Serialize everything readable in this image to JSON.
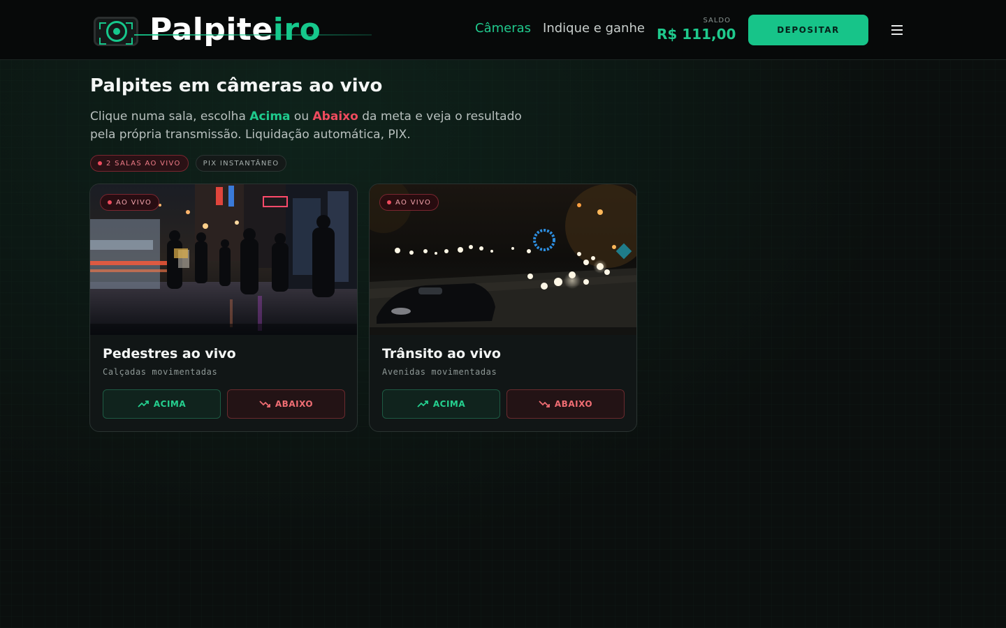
{
  "header": {
    "logo": {
      "part1": "Palpite",
      "part2": "iro"
    },
    "nav": [
      {
        "label": "Câmeras",
        "active": true
      },
      {
        "label": "Indique e ganhe",
        "active": false
      }
    ],
    "balance": {
      "label": "SALDO",
      "value": "R$ 111,00"
    },
    "deposit_label": "DEPOSITAR"
  },
  "hero": {
    "title": "Palpites em câmeras ao vivo",
    "subtitle_part1": "Clique numa sala, escolha ",
    "subtitle_up": "Acima",
    "subtitle_part2": " ou ",
    "subtitle_down": "Abaixo",
    "subtitle_part3": " da meta e veja o resultado pela própria transmissão. Liquidação automática, PIX.",
    "chips": {
      "live": "2 SALAS AO VIVO",
      "pix": "PIX INSTANTÂNEO"
    }
  },
  "cards": [
    {
      "badge": "AO VIVO",
      "title": "Pedestres ao vivo",
      "subtitle": "Calçadas movimentadas",
      "up_label": "ACIMA",
      "down_label": "ABAIXO"
    },
    {
      "badge": "AO VIVO",
      "title": "Trânsito ao vivo",
      "subtitle": "Avenidas movimentadas",
      "up_label": "ACIMA",
      "down_label": "ABAIXO"
    }
  ],
  "colors": {
    "accent": "#17c489",
    "down": "#ef4b5e",
    "background": "#0b0f0e"
  },
  "icons": {
    "menu": "hamburger-menu-icon",
    "up": "trending-up-icon",
    "down": "trending-down-icon",
    "live": "live-dot-icon"
  }
}
